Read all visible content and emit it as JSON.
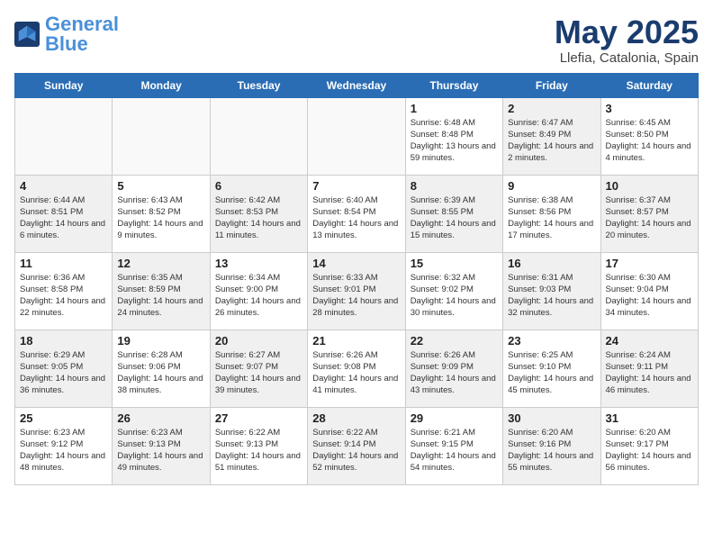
{
  "logo": {
    "text1": "General",
    "text2": "Blue"
  },
  "title": "May 2025",
  "subtitle": "Llefia, Catalonia, Spain",
  "days_header": [
    "Sunday",
    "Monday",
    "Tuesday",
    "Wednesday",
    "Thursday",
    "Friday",
    "Saturday"
  ],
  "weeks": [
    [
      {
        "num": "",
        "info": "",
        "shaded": false,
        "empty": true
      },
      {
        "num": "",
        "info": "",
        "shaded": false,
        "empty": true
      },
      {
        "num": "",
        "info": "",
        "shaded": false,
        "empty": true
      },
      {
        "num": "",
        "info": "",
        "shaded": false,
        "empty": true
      },
      {
        "num": "1",
        "info": "Sunrise: 6:48 AM\nSunset: 8:48 PM\nDaylight: 13 hours and 59 minutes.",
        "shaded": false,
        "empty": false
      },
      {
        "num": "2",
        "info": "Sunrise: 6:47 AM\nSunset: 8:49 PM\nDaylight: 14 hours and 2 minutes.",
        "shaded": true,
        "empty": false
      },
      {
        "num": "3",
        "info": "Sunrise: 6:45 AM\nSunset: 8:50 PM\nDaylight: 14 hours and 4 minutes.",
        "shaded": false,
        "empty": false
      }
    ],
    [
      {
        "num": "4",
        "info": "Sunrise: 6:44 AM\nSunset: 8:51 PM\nDaylight: 14 hours and 6 minutes.",
        "shaded": true,
        "empty": false
      },
      {
        "num": "5",
        "info": "Sunrise: 6:43 AM\nSunset: 8:52 PM\nDaylight: 14 hours and 9 minutes.",
        "shaded": false,
        "empty": false
      },
      {
        "num": "6",
        "info": "Sunrise: 6:42 AM\nSunset: 8:53 PM\nDaylight: 14 hours and 11 minutes.",
        "shaded": true,
        "empty": false
      },
      {
        "num": "7",
        "info": "Sunrise: 6:40 AM\nSunset: 8:54 PM\nDaylight: 14 hours and 13 minutes.",
        "shaded": false,
        "empty": false
      },
      {
        "num": "8",
        "info": "Sunrise: 6:39 AM\nSunset: 8:55 PM\nDaylight: 14 hours and 15 minutes.",
        "shaded": true,
        "empty": false
      },
      {
        "num": "9",
        "info": "Sunrise: 6:38 AM\nSunset: 8:56 PM\nDaylight: 14 hours and 17 minutes.",
        "shaded": false,
        "empty": false
      },
      {
        "num": "10",
        "info": "Sunrise: 6:37 AM\nSunset: 8:57 PM\nDaylight: 14 hours and 20 minutes.",
        "shaded": true,
        "empty": false
      }
    ],
    [
      {
        "num": "11",
        "info": "Sunrise: 6:36 AM\nSunset: 8:58 PM\nDaylight: 14 hours and 22 minutes.",
        "shaded": false,
        "empty": false
      },
      {
        "num": "12",
        "info": "Sunrise: 6:35 AM\nSunset: 8:59 PM\nDaylight: 14 hours and 24 minutes.",
        "shaded": true,
        "empty": false
      },
      {
        "num": "13",
        "info": "Sunrise: 6:34 AM\nSunset: 9:00 PM\nDaylight: 14 hours and 26 minutes.",
        "shaded": false,
        "empty": false
      },
      {
        "num": "14",
        "info": "Sunrise: 6:33 AM\nSunset: 9:01 PM\nDaylight: 14 hours and 28 minutes.",
        "shaded": true,
        "empty": false
      },
      {
        "num": "15",
        "info": "Sunrise: 6:32 AM\nSunset: 9:02 PM\nDaylight: 14 hours and 30 minutes.",
        "shaded": false,
        "empty": false
      },
      {
        "num": "16",
        "info": "Sunrise: 6:31 AM\nSunset: 9:03 PM\nDaylight: 14 hours and 32 minutes.",
        "shaded": true,
        "empty": false
      },
      {
        "num": "17",
        "info": "Sunrise: 6:30 AM\nSunset: 9:04 PM\nDaylight: 14 hours and 34 minutes.",
        "shaded": false,
        "empty": false
      }
    ],
    [
      {
        "num": "18",
        "info": "Sunrise: 6:29 AM\nSunset: 9:05 PM\nDaylight: 14 hours and 36 minutes.",
        "shaded": true,
        "empty": false
      },
      {
        "num": "19",
        "info": "Sunrise: 6:28 AM\nSunset: 9:06 PM\nDaylight: 14 hours and 38 minutes.",
        "shaded": false,
        "empty": false
      },
      {
        "num": "20",
        "info": "Sunrise: 6:27 AM\nSunset: 9:07 PM\nDaylight: 14 hours and 39 minutes.",
        "shaded": true,
        "empty": false
      },
      {
        "num": "21",
        "info": "Sunrise: 6:26 AM\nSunset: 9:08 PM\nDaylight: 14 hours and 41 minutes.",
        "shaded": false,
        "empty": false
      },
      {
        "num": "22",
        "info": "Sunrise: 6:26 AM\nSunset: 9:09 PM\nDaylight: 14 hours and 43 minutes.",
        "shaded": true,
        "empty": false
      },
      {
        "num": "23",
        "info": "Sunrise: 6:25 AM\nSunset: 9:10 PM\nDaylight: 14 hours and 45 minutes.",
        "shaded": false,
        "empty": false
      },
      {
        "num": "24",
        "info": "Sunrise: 6:24 AM\nSunset: 9:11 PM\nDaylight: 14 hours and 46 minutes.",
        "shaded": true,
        "empty": false
      }
    ],
    [
      {
        "num": "25",
        "info": "Sunrise: 6:23 AM\nSunset: 9:12 PM\nDaylight: 14 hours and 48 minutes.",
        "shaded": false,
        "empty": false
      },
      {
        "num": "26",
        "info": "Sunrise: 6:23 AM\nSunset: 9:13 PM\nDaylight: 14 hours and 49 minutes.",
        "shaded": true,
        "empty": false
      },
      {
        "num": "27",
        "info": "Sunrise: 6:22 AM\nSunset: 9:13 PM\nDaylight: 14 hours and 51 minutes.",
        "shaded": false,
        "empty": false
      },
      {
        "num": "28",
        "info": "Sunrise: 6:22 AM\nSunset: 9:14 PM\nDaylight: 14 hours and 52 minutes.",
        "shaded": true,
        "empty": false
      },
      {
        "num": "29",
        "info": "Sunrise: 6:21 AM\nSunset: 9:15 PM\nDaylight: 14 hours and 54 minutes.",
        "shaded": false,
        "empty": false
      },
      {
        "num": "30",
        "info": "Sunrise: 6:20 AM\nSunset: 9:16 PM\nDaylight: 14 hours and 55 minutes.",
        "shaded": true,
        "empty": false
      },
      {
        "num": "31",
        "info": "Sunrise: 6:20 AM\nSunset: 9:17 PM\nDaylight: 14 hours and 56 minutes.",
        "shaded": false,
        "empty": false
      }
    ]
  ]
}
